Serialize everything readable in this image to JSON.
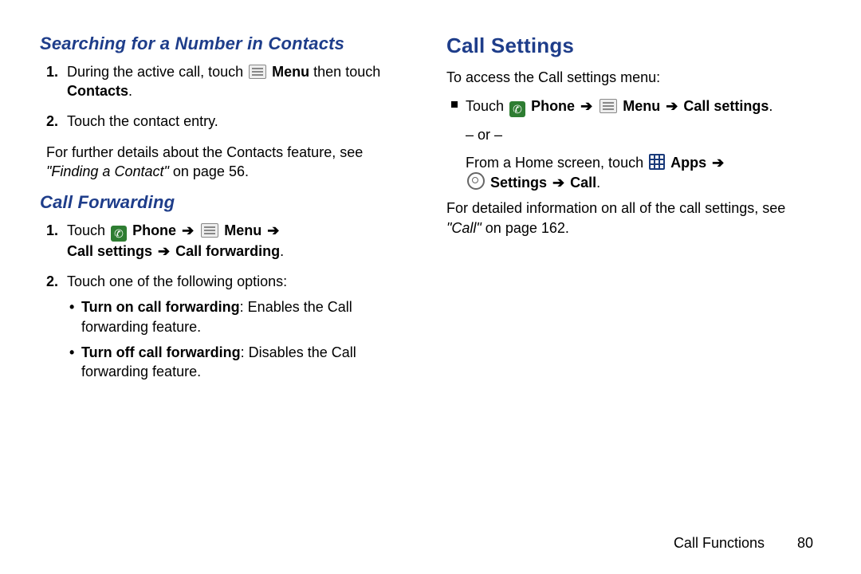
{
  "left": {
    "h1": "Searching for a Number in Contacts",
    "steps": [
      {
        "n": "1.",
        "pre": "During the active call, touch ",
        "menuLabel": "Menu",
        "mid": " then touch ",
        "contacts": "Contacts",
        "post": "."
      },
      {
        "n": "2.",
        "text": "Touch the contact entry."
      }
    ],
    "para1a": "For further details about the Contacts feature, see ",
    "para1b": "\"Finding a Contact\"",
    "para1c": " on page 56.",
    "h2": "Call Forwarding",
    "cfStep1": {
      "n": "1.",
      "touch": "Touch ",
      "phone": "Phone",
      "menu": "Menu",
      "line2a": "Call settings",
      "line2b": "Call forwarding",
      "dot": "."
    },
    "cfStep2": {
      "n": "2.",
      "text": "Touch one of the following options:"
    },
    "bullets": [
      {
        "b": "Turn on call forwarding",
        "rest": ": Enables the Call forwarding feature."
      },
      {
        "b": "Turn off call forwarding",
        "rest": ": Disables the Call forwarding feature."
      }
    ],
    "arrow": "➔"
  },
  "right": {
    "h1": "Call Settings",
    "intro": "To access the Call settings menu:",
    "sq": {
      "touch": "Touch ",
      "phone": "Phone",
      "menu": "Menu",
      "callSettings": "Call settings",
      "dot": ".",
      "or": "– or –",
      "fromHome": "From a Home screen, touch ",
      "apps": "Apps",
      "settings": "Settings",
      "call": "Call"
    },
    "para2a": "For detailed information on all of the call settings, see ",
    "para2b": "\"Call\"",
    "para2c": " on page 162.",
    "arrow": "➔"
  },
  "footer": {
    "section": "Call Functions",
    "page": "80"
  }
}
